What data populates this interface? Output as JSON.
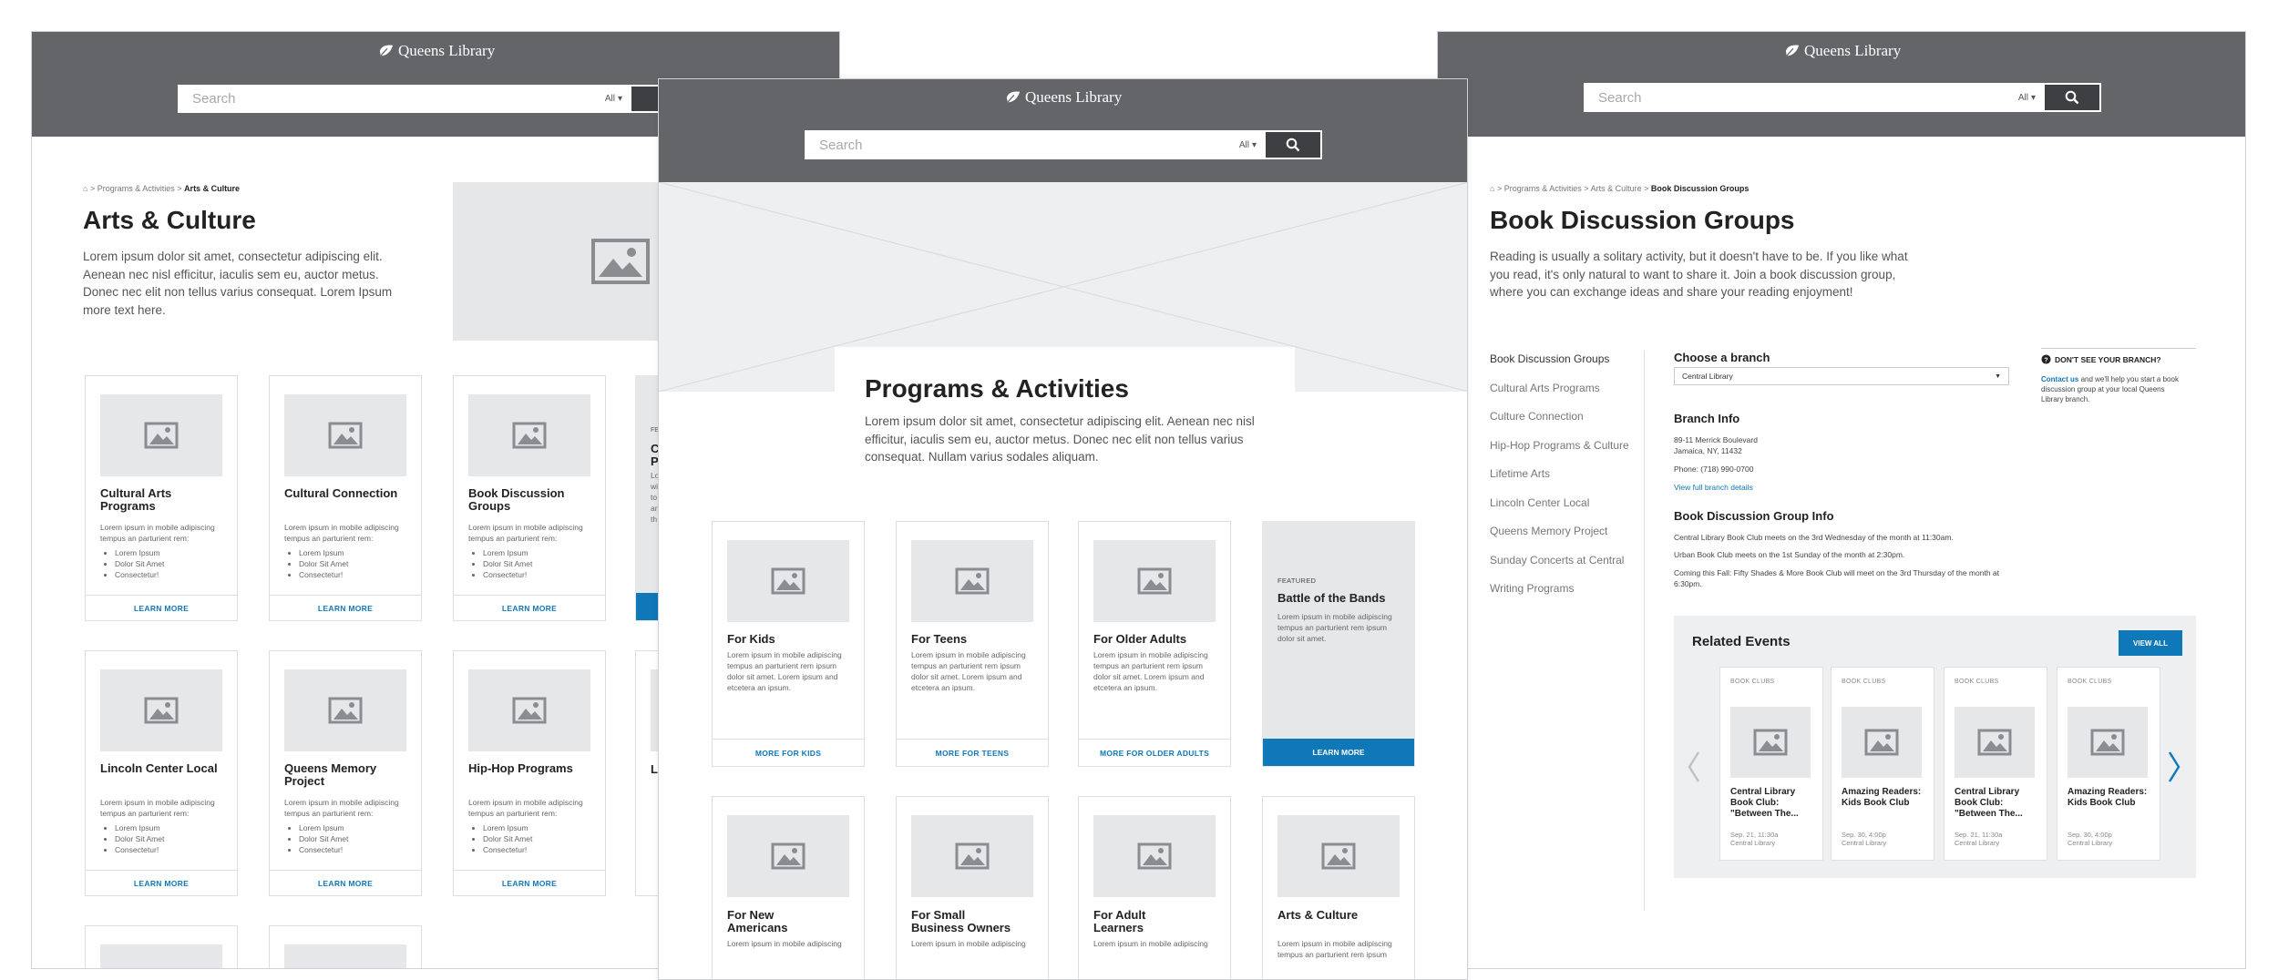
{
  "brand": {
    "logo_text": "Queens Library"
  },
  "search": {
    "placeholder": "Search",
    "scope": "All"
  },
  "arts_page": {
    "breadcrumb": {
      "home": "⌂",
      "sep": ">",
      "parent": "Programs & Activities",
      "current": "Arts & Culture"
    },
    "title": "Arts & Culture",
    "intro": "Lorem ipsum dolor sit amet, consectetur adipiscing elit. Aenean nec nisl efficitur, iaculis sem eu, auctor metus. Donec nec elit non tellus varius consequat. Lorem Ipsum more text here.",
    "cards": [
      {
        "title": "Cultural Arts Programs",
        "desc": "Lorem ipsum in mobile adipiscing tempus an parturient rem:",
        "bullets": [
          "Lorem Ipsum",
          "Dolor Sit Amet",
          "Consectetur!"
        ],
        "cta": "LEARN MORE"
      },
      {
        "title": "Cultural Connection",
        "desc": "Lorem ipsum in mobile adipiscing tempus an parturient rem:",
        "bullets": [
          "Lorem Ipsum",
          "Dolor Sit Amet",
          "Consectetur!"
        ],
        "cta": "LEARN MORE"
      },
      {
        "title": "Book Discussion Groups",
        "desc": "Lorem ipsum in mobile adipiscing tempus an parturient rem:",
        "bullets": [
          "Lorem Ipsum",
          "Dolor Sit Amet",
          "Consectetur!"
        ],
        "cta": "LEARN MORE"
      },
      {
        "title": "Lincoln Center Local",
        "desc": "Lorem ipsum in mobile adipiscing tempus an parturient rem:",
        "bullets": [
          "Lorem Ipsum",
          "Dolor Sit Amet",
          "Consectetur!"
        ],
        "cta": "LEARN MORE"
      },
      {
        "title": "Queens Memory Project",
        "desc": "Lorem ipsum in mobile adipiscing tempus an parturient rem:",
        "bullets": [
          "Lorem Ipsum",
          "Dolor Sit Amet",
          "Consectetur!"
        ],
        "cta": "LEARN MORE"
      },
      {
        "title": "Hip-Hop Programs",
        "desc": "Lorem ipsum in mobile adipiscing tempus an parturient rem:",
        "bullets": [
          "Lorem Ipsum",
          "Dolor Sit Amet",
          "Consectetur!"
        ],
        "cta": "LEARN MORE"
      }
    ],
    "partial": {
      "tag": "FE",
      "title_1": "C",
      "title_2": "P",
      "lines": [
        "Lo",
        "wi",
        "to",
        "an",
        "th"
      ],
      "title_3": "L"
    }
  },
  "programs_page": {
    "title": "Programs & Activities",
    "intro": "Lorem ipsum dolor sit amet, consectetur adipiscing elit. Aenean nec nisl efficitur, iaculis sem eu, auctor metus. Donec nec elit non tellus varius consequat. Nullam varius sodales aliquam.",
    "cards": [
      {
        "title": "For Kids",
        "desc": "Lorem ipsum in mobile adipiscing tempus an parturient rem ipsum dolor sit amet. Lorem ipsum and etcetera an ipsum.",
        "cta": "MORE FOR KIDS"
      },
      {
        "title": "For Teens",
        "desc": "Lorem ipsum in mobile adipiscing tempus an parturient rem ipsum dolor sit amet. Lorem ipsum and etcetera an ipsum.",
        "cta": "MORE FOR TEENS"
      },
      {
        "title": "For Older Adults",
        "desc": "Lorem ipsum in mobile adipiscing tempus an parturient rem ipsum dolor sit amet. Lorem ipsum and etcetera an ipsum.",
        "cta": "MORE FOR OLDER ADULTS"
      }
    ],
    "featured": {
      "tag": "FEATURED",
      "title": "Battle of the Bands",
      "desc": "Lorem ipsum in mobile adipiscing tempus an parturient rem ipsum dolor sit amet.",
      "cta": "LEARN MORE"
    },
    "row2": [
      {
        "title": "For New Americans",
        "desc": "Lorem ipsum in mobile adipiscing"
      },
      {
        "title": "For Small Business Owners",
        "desc": "Lorem ipsum in mobile adipiscing"
      },
      {
        "title": "For Adult Learners",
        "desc": "Lorem ipsum in mobile adipiscing"
      },
      {
        "title": "Arts & Culture",
        "desc": "Lorem ipsum in mobile adipiscing tempus an parturient rem ipsum"
      }
    ]
  },
  "book_page": {
    "breadcrumb": {
      "home": "⌂",
      "sep": ">",
      "parent": "Programs & Activities",
      "mid": "Arts & Culture",
      "current": "Book Discussion Groups"
    },
    "title": "Book Discussion Groups",
    "intro": "Reading is usually a solitary activity, but it doesn't have to be. If you like what you read, it's only natural to want to share it. Join a book discussion group, where you can exchange ideas and share your reading enjoyment!",
    "sidenav": [
      "Book Discussion Groups",
      "Cultural Arts Programs",
      "Culture Connection",
      "Hip-Hop Programs & Culture",
      "Lifetime Arts",
      "Lincoln Center Local",
      "Queens Memory Project",
      "Sunday Concerts at Central",
      "Writing Programs"
    ],
    "branch_label": "Choose a branch",
    "branch_value": "Central Library",
    "branch_info": {
      "heading": "Branch Info",
      "addr1": "89-11 Merrick Boulevard",
      "addr2": "Jamaica, NY, 11432",
      "phone": "Phone: (718) 990-0700",
      "link": "View full branch details"
    },
    "group_info": {
      "heading": "Book Discussion Group Info",
      "lines": [
        "Central Library Book Club meets on the 3rd Wednesday of the month at 11:30am.",
        "Urban Book Club meets on the 1st Sunday of the month at 2:30pm.",
        "Coming this Fall: Fifty Shades & More Book Club will meet on the 3rd Thursday of the month at 6:30pm."
      ]
    },
    "aside": {
      "heading": "DON'T SEE YOUR BRANCH?",
      "link": "Contact us",
      "text": " and we'll help you  start a book discussion group at your local Queens Library branch."
    },
    "events": {
      "heading": "Related Events",
      "view_all": "VIEW ALL",
      "items": [
        {
          "tag": "BOOK CLUBS",
          "title": "Central Library Book Club: \"Between The...",
          "date": "Sep. 21, 11:30a",
          "loc": "Central Library"
        },
        {
          "tag": "BOOK CLUBS",
          "title": "Amazing Readers: Kids Book Club",
          "date": "Sep. 30, 4:00p",
          "loc": "Central Library"
        },
        {
          "tag": "BOOK CLUBS",
          "title": "Central Library Book Club: \"Between The...",
          "date": "Sep. 21, 11:30a",
          "loc": "Central Library"
        },
        {
          "tag": "BOOK CLUBS",
          "title": "Amazing Readers: Kids Book Club",
          "date": "Sep. 30, 4:00p",
          "loc": "Central Library"
        }
      ]
    }
  },
  "colors": {
    "header": "#636569",
    "accent": "#0f78b8",
    "placeholder": "#e6e7e9",
    "button": "#3d3f42"
  }
}
